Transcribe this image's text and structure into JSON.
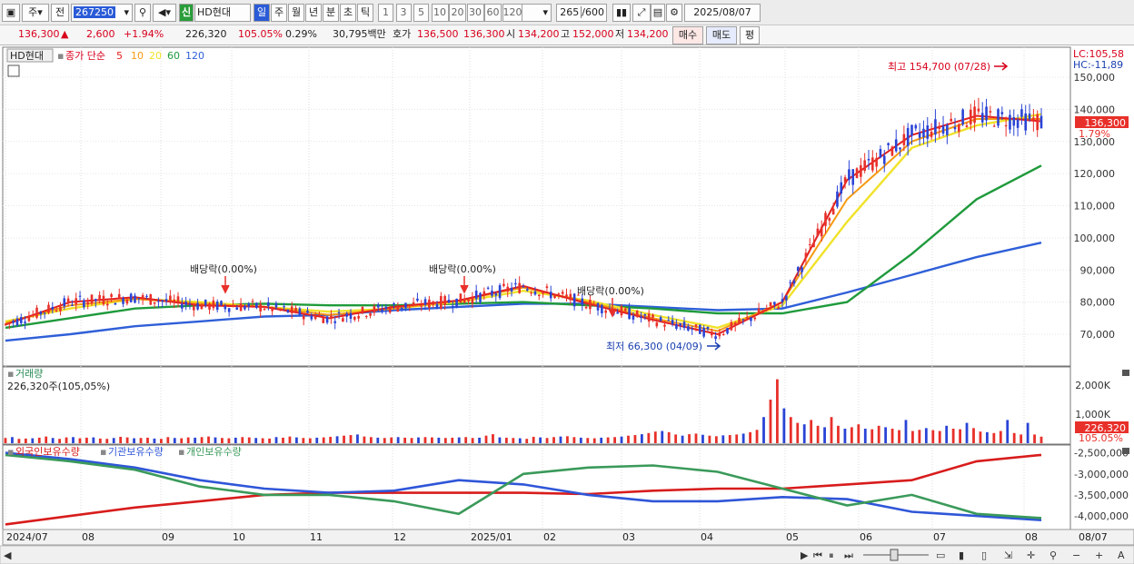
{
  "toolbar": {
    "type_label": "주",
    "prev_label": "전",
    "code": "267250",
    "market_badge": "신",
    "stock_name": "HD현대",
    "period_tabs": [
      "일",
      "주",
      "월",
      "년",
      "분",
      "초",
      "틱"
    ],
    "active_period": "일",
    "interval_buttons": [
      "1",
      "3",
      "5",
      "10",
      "20",
      "30",
      "60",
      "120"
    ],
    "count": "265",
    "count_max": "/600",
    "date": "2025/08/07"
  },
  "quote": {
    "price": "136,300",
    "arrow": "▲",
    "change": "2,600",
    "change_pct": "+1.94%",
    "volume": "226,320",
    "volume_ratio": "105.05%",
    "turnover": "0.29%",
    "trade_value": "30,795백만",
    "bid_label": "호가",
    "bid": "136,500",
    "ask": "136,300",
    "open_label": "시",
    "open": "134,200",
    "high_label": "고",
    "high": "152,000",
    "low_label": "저",
    "low": "134,200",
    "buy_label": "매수",
    "sell_label": "매도",
    "eval_label": "평"
  },
  "legend": {
    "name": "HD현대",
    "ma_prefix": "종가 단순",
    "ma": [
      "5",
      "10",
      "20",
      "60",
      "120"
    ]
  },
  "annotations": {
    "dividend": "배당락(0.00%)",
    "high": "최고 154,700 (07/28)",
    "low": "최저 66,300 (04/09)",
    "lc": "LC:105,58",
    "hc": "HC:-11,89",
    "last_price": "136,300",
    "last_pct": "1.79%"
  },
  "volume": {
    "title": "거래량",
    "detail": "226,320주(105,05%)",
    "last": "226,320",
    "last_pct": "105.05%"
  },
  "holdings": {
    "series_labels": [
      "외국인보유수량",
      "기관보유수량",
      "개인보유수량"
    ]
  },
  "x_labels": [
    "2024/07",
    "08",
    "09",
    "10",
    "11",
    "12",
    "2025/01",
    "02",
    "03",
    "04",
    "05",
    "06",
    "07",
    "08"
  ],
  "x_end": "08/07",
  "colors": {
    "up": "#e8302a",
    "down": "#2a44d6",
    "ma5": "#e2201e",
    "ma10": "#f59a12",
    "ma20": "#f0e22a",
    "ma60": "#1f9a3c",
    "ma120": "#2f5fd8",
    "foreign": "#d81c1c",
    "institution": "#2f56d8",
    "individual": "#3a9a5a"
  },
  "chart_data": [
    {
      "type": "line",
      "title": "",
      "x": [
        "2024/07",
        "08",
        "09",
        "10",
        "11",
        "12",
        "2025/01",
        "02",
        "03",
        "04",
        "05",
        "06",
        "07",
        "08"
      ],
      "price_axis": {
        "min": 60000,
        "max": 160000,
        "ticks": [
          70000,
          80000,
          90000,
          100000,
          110000,
          120000,
          130000,
          140000,
          150000
        ]
      },
      "tick_labels": [
        "70,000",
        "80,000",
        "90,000",
        "100,000",
        "110,000",
        "120,000",
        "130,000",
        "140,000",
        "150,000"
      ],
      "series": [
        {
          "name": "5",
          "values": [
            73000,
            80000,
            81500,
            79000,
            78500,
            75000,
            78500,
            80500,
            85000,
            79500,
            74500,
            70000,
            80000,
            118000,
            132000,
            138000,
            136300
          ]
        },
        {
          "name": "10",
          "values": [
            73500,
            79000,
            81000,
            79500,
            78500,
            76000,
            78000,
            80500,
            84500,
            80000,
            75000,
            71000,
            80000,
            112000,
            130000,
            137000,
            137000
          ]
        },
        {
          "name": "20",
          "values": [
            74000,
            78000,
            81000,
            80000,
            78500,
            77000,
            78000,
            80000,
            83500,
            80500,
            76000,
            72000,
            79000,
            105000,
            128000,
            135000,
            138500
          ]
        },
        {
          "name": "60",
          "values": [
            72000,
            75000,
            78000,
            79000,
            79500,
            79000,
            79000,
            79500,
            80000,
            79000,
            78000,
            76500,
            76500,
            80000,
            95000,
            112000,
            122500
          ]
        },
        {
          "name": "120",
          "values": [
            68000,
            70000,
            72500,
            74000,
            75500,
            76000,
            77500,
            78500,
            79500,
            79500,
            78500,
            77500,
            78000,
            83000,
            88500,
            94000,
            98500
          ]
        }
      ],
      "markers": {
        "high": 154700,
        "low": 66300,
        "last": 136300
      }
    },
    {
      "type": "bar",
      "title": "",
      "ylabel": "",
      "axis_ticks": [
        "1,000K",
        "2,000K"
      ],
      "values": [
        180,
        210,
        150,
        160,
        170,
        190,
        230,
        180,
        150,
        200,
        210,
        170,
        190,
        200,
        160,
        150,
        180,
        220,
        200,
        170,
        180,
        190,
        160,
        150,
        210,
        180,
        170,
        200,
        190,
        210,
        230,
        200,
        180,
        170,
        190,
        210,
        200,
        180,
        170,
        160,
        210,
        190,
        230,
        200,
        180,
        170,
        190,
        200,
        220,
        240,
        260,
        280,
        300,
        230,
        210,
        190,
        180,
        200,
        210,
        190,
        180,
        200,
        210,
        200,
        190,
        180,
        190,
        200,
        210,
        180,
        190,
        260,
        310,
        200,
        190,
        180,
        170,
        150,
        220,
        200,
        180,
        210,
        230,
        240,
        210,
        190,
        180,
        170,
        190,
        200,
        210,
        230,
        260,
        280,
        310,
        350,
        400,
        420,
        380,
        300,
        260,
        310,
        330,
        290,
        260,
        240,
        270,
        280,
        300,
        330,
        380,
        460,
        900,
        1500,
        2200,
        1200,
        900,
        700,
        650,
        800,
        600,
        550,
        900,
        600,
        500,
        550,
        650,
        500,
        480,
        600,
        550,
        500,
        450,
        800,
        420,
        460,
        520,
        450,
        420,
        600,
        500,
        480,
        700,
        520,
        400,
        380,
        350,
        420,
        800,
        350,
        300,
        700,
        300,
        226
      ]
    },
    {
      "type": "line",
      "title": "",
      "ylim": [
        -4300000,
        -2400000
      ],
      "tick_labels": [
        "-2,500,000",
        "-3,000,000",
        "-3,500,000",
        "-4,000,000"
      ],
      "series": [
        {
          "name": "외국인보유수량",
          "values": [
            -4200000,
            -4000000,
            -3800000,
            -3650000,
            -3500000,
            -3450000,
            -3450000,
            -3450000,
            -3450000,
            -3480000,
            -3400000,
            -3350000,
            -3350000,
            -3250000,
            -3150000,
            -2700000,
            -2550000
          ]
        },
        {
          "name": "기관보유수량",
          "values": [
            -2500000,
            -2650000,
            -2850000,
            -3150000,
            -3350000,
            -3450000,
            -3400000,
            -3150000,
            -3250000,
            -3500000,
            -3650000,
            -3650000,
            -3550000,
            -3600000,
            -3900000,
            -4000000,
            -4100000
          ]
        },
        {
          "name": "개인보유수량",
          "values": [
            -2550000,
            -2700000,
            -2900000,
            -3300000,
            -3500000,
            -3500000,
            -3650000,
            -3950000,
            -3000000,
            -2850000,
            -2800000,
            -2950000,
            -3350000,
            -3750000,
            -3500000,
            -3950000,
            -4050000
          ]
        }
      ]
    }
  ]
}
